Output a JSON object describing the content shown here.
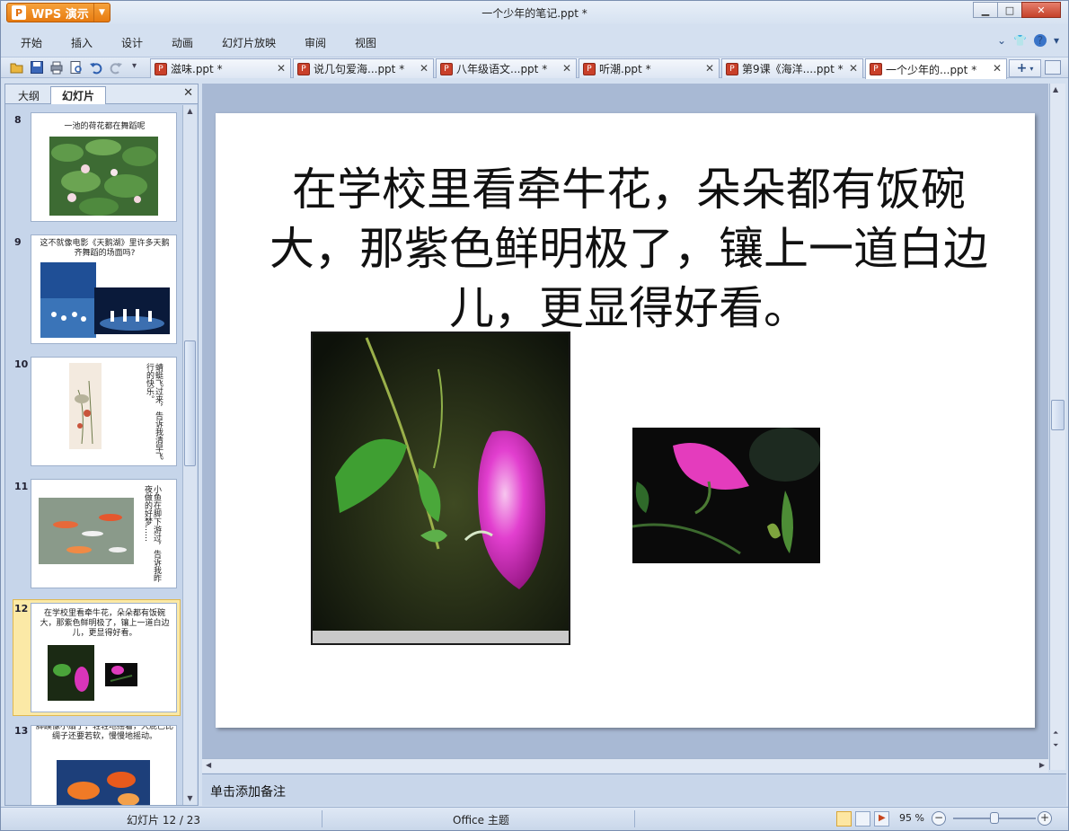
{
  "app": {
    "name": "WPS 演示",
    "window_title": "一个少年的笔记.ppt *"
  },
  "menu": [
    "开始",
    "插入",
    "设计",
    "动画",
    "幻灯片放映",
    "审阅",
    "视图"
  ],
  "tabs": [
    {
      "label": "滋味.ppt *"
    },
    {
      "label": "说几句爱海...ppt *"
    },
    {
      "label": "八年级语文...ppt *"
    },
    {
      "label": "听潮.ppt *"
    },
    {
      "label": "第9课《海洋....ppt *"
    },
    {
      "label": "一个少年的...ppt *"
    }
  ],
  "panel": {
    "tab_outline": "大纲",
    "tab_slides": "幻灯片"
  },
  "thumbnails": [
    {
      "num": "8",
      "text": "一池的荷花都在舞蹈呢"
    },
    {
      "num": "9",
      "text": "这不就像电影《天鹅湖》里许多天鹅齐舞蹈的场面吗?"
    },
    {
      "num": "10",
      "text": "蜻蜓飞过来，告诉我清早飞行的快乐。"
    },
    {
      "num": "11",
      "text": "小鱼在脚下游过，告诉我昨夜做的好梦……"
    },
    {
      "num": "12",
      "text": "在学校里看牵牛花，朵朵都有饭碗大，那紫色鲜明极了，镶上一道白边儿，更显得好看。"
    },
    {
      "num": "13",
      "text": "脚蹼像小扇子，轻轻地摇着，大屁巴比绸子还要若软，慢慢地摇动。"
    }
  ],
  "slide": {
    "title": "在学校里看牵牛花，朵朵都有饭碗大，那紫色鲜明极了，镶上一道白边儿，更显得好看。"
  },
  "notes_placeholder": "单击添加备注",
  "status": {
    "slide_counter": "幻灯片 12 / 23",
    "theme": "Office 主题",
    "zoom": "95 %",
    "zoom_fraction": 0.5
  },
  "colors": {
    "accent": "#e77b10",
    "selected_thumb": "#fbe9a6",
    "workspace": "#a8b9d4"
  },
  "icons": [
    "open-icon",
    "save-icon",
    "print-icon",
    "preview-icon",
    "undo-icon",
    "redo-icon",
    "help-icon",
    "skin-icon"
  ]
}
